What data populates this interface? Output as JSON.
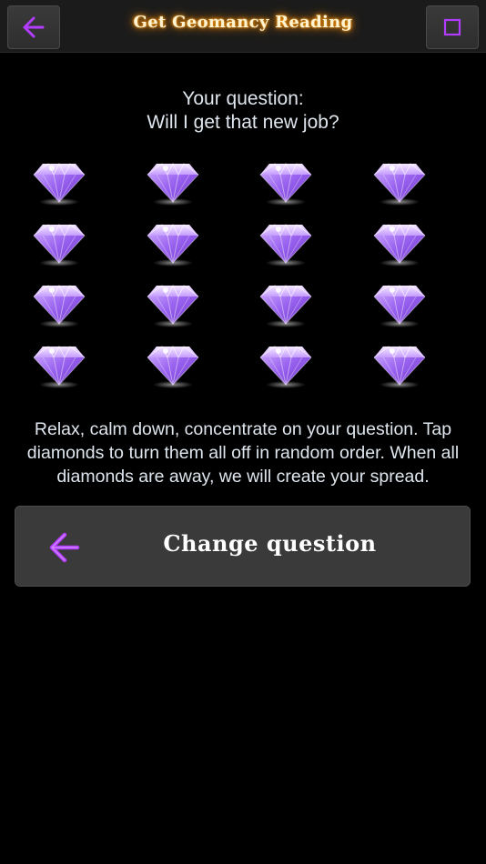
{
  "header": {
    "title": "Get Geomancy Reading",
    "back_icon": "arrow-left-icon",
    "right_icon": "square-icon"
  },
  "question": {
    "label": "Your question:",
    "text": "Will I get that new job?"
  },
  "gems": {
    "rows": 4,
    "cols": 4,
    "icon": "diamond-icon",
    "states": [
      [
        true,
        true,
        true,
        true
      ],
      [
        true,
        true,
        true,
        true
      ],
      [
        true,
        true,
        true,
        true
      ],
      [
        true,
        true,
        true,
        true
      ]
    ]
  },
  "instructions": "Relax, calm down, concentrate on your question. Tap diamonds to turn them all off in random order. When all diamonds are away, we will create your spread.",
  "change_button": {
    "label": "Change question",
    "icon": "arrow-left-icon"
  },
  "colors": {
    "accent": "#b23cff",
    "title_glow": "#ff9a00",
    "background": "#000000"
  }
}
